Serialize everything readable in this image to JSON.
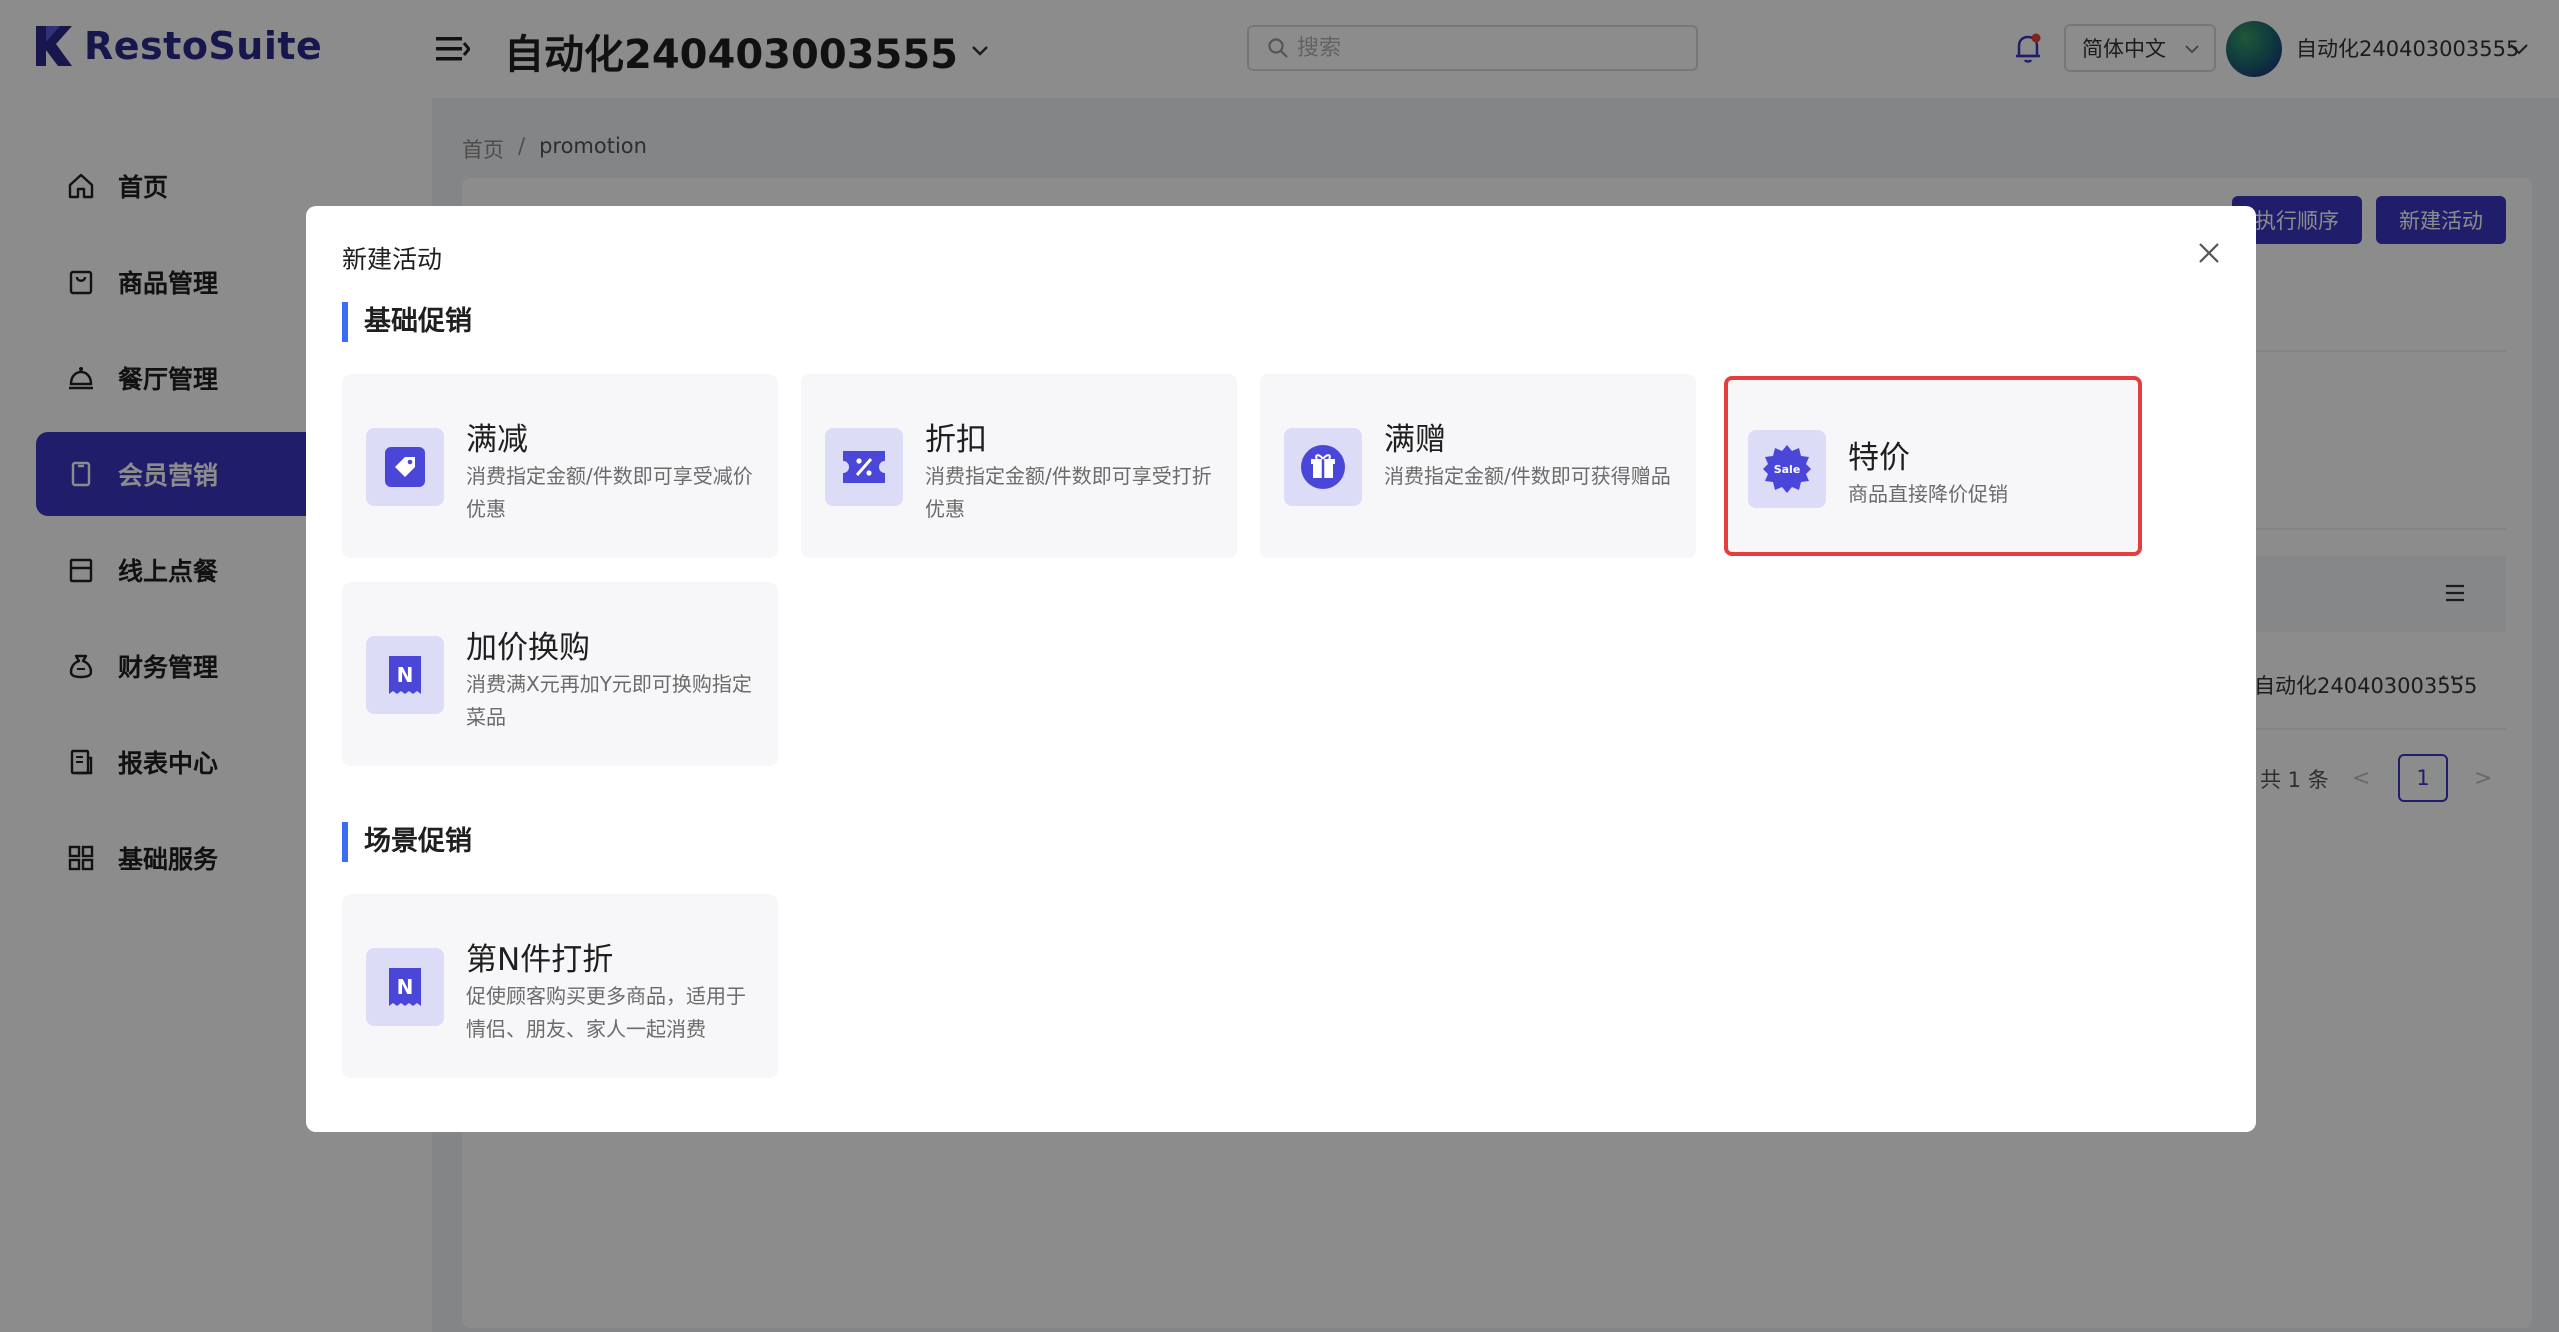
{
  "header": {
    "logo_text": "RestoSuite",
    "store_name": "自动化240403003555",
    "search_placeholder": "搜索",
    "language": "简体中文",
    "user_name": "自动化240403003555"
  },
  "sidebar": {
    "items": [
      {
        "label": "首页",
        "icon": "home-icon"
      },
      {
        "label": "商品管理",
        "icon": "bag-icon"
      },
      {
        "label": "餐厅管理",
        "icon": "cloche-icon"
      },
      {
        "label": "会员营销",
        "icon": "tablet-icon",
        "active": true
      },
      {
        "label": "线上点餐",
        "icon": "store-icon"
      },
      {
        "label": "财务管理",
        "icon": "money-bag-icon"
      },
      {
        "label": "报表中心",
        "icon": "report-icon"
      },
      {
        "label": "基础服务",
        "icon": "grid-icon"
      }
    ]
  },
  "breadcrumb": {
    "home": "首页",
    "separator": "/",
    "current": "promotion"
  },
  "toolbar": {
    "order_label": "执行顺序",
    "new_label": "新建活动"
  },
  "table": {
    "cell_text": "自动化240403003555",
    "more": "···",
    "total": "共 1 条",
    "page": "1",
    "prev": "<",
    "next": ">"
  },
  "modal": {
    "title": "新建活动",
    "sections": [
      {
        "title": "基础促销",
        "cards": [
          {
            "name": "满减",
            "desc": "消费指定金额/件数即可享受减价优惠",
            "icon": "tag-icon"
          },
          {
            "name": "折扣",
            "desc": "消费指定金额/件数即可享受打折优惠",
            "icon": "percent-ticket-icon"
          },
          {
            "name": "满赠",
            "desc": "消费指定金额/件数即可获得赠品",
            "icon": "gift-icon"
          },
          {
            "name": "特价",
            "desc": "商品直接降价促销",
            "icon": "sale-badge-icon",
            "selected": true
          },
          {
            "name": "加价换购",
            "desc": "消费满X元再加Y元即可换购指定菜品",
            "icon": "n-ticket-icon"
          }
        ]
      },
      {
        "title": "场景促销",
        "cards": [
          {
            "name": "第N件打折",
            "desc": "促使顾客购买更多商品，适用于情侣、朋友、家人一起消费",
            "icon": "n-ticket-icon"
          }
        ]
      }
    ],
    "sale_badge_text": "Sale",
    "n_letter": "N"
  },
  "colors": {
    "primary": "#3b36c4",
    "accent_bar": "#3b6cf6",
    "selected_border": "#e53e3e",
    "icon_bg": "#dcdcf7",
    "notification": "#e53e3e"
  }
}
